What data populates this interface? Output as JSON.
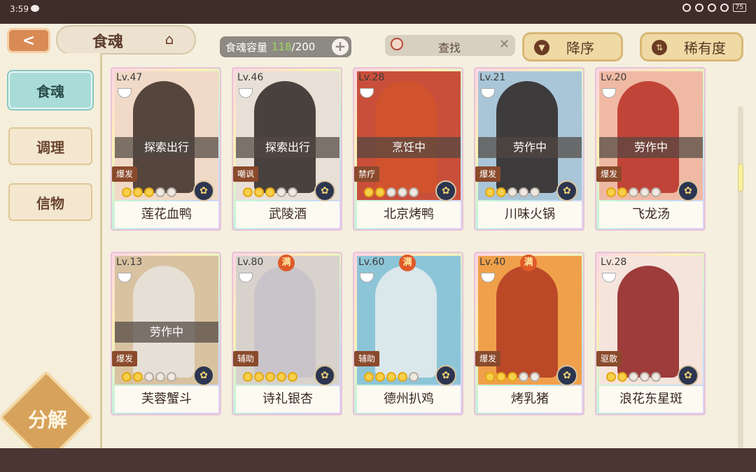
{
  "status_bar": {
    "time": "3:59",
    "battery": "75"
  },
  "header": {
    "title": "食魂",
    "capacity_label": "食魂容量",
    "capacity_current": "118",
    "capacity_max": "/200",
    "search_label": "查找",
    "sort_desc_label": "降序",
    "sort_rarity_label": "稀有度"
  },
  "sidebar": {
    "tabs": [
      {
        "label": "食魂"
      },
      {
        "label": "调理"
      },
      {
        "label": "信物"
      }
    ],
    "decompose_label": "分解"
  },
  "cards": [
    {
      "level": "Lv.47",
      "status": "探索出行",
      "role": "爆发",
      "stars": 3,
      "name": "莲花血鸭",
      "max": false
    },
    {
      "level": "Lv.46",
      "status": "探索出行",
      "role": "嘲讽",
      "stars": 3,
      "name": "武陵酒",
      "max": false
    },
    {
      "level": "Lv.28",
      "status": "烹饪中",
      "role": "禁疗",
      "stars": 2,
      "name": "北京烤鸭",
      "max": false
    },
    {
      "level": "Lv.21",
      "status": "劳作中",
      "role": "爆发",
      "stars": 2,
      "name": "川味火锅",
      "max": false
    },
    {
      "level": "Lv.20",
      "status": "劳作中",
      "role": "爆发",
      "stars": 2,
      "name": "飞龙汤",
      "max": false
    },
    {
      "level": "Lv.13",
      "status": "劳作中",
      "role": "爆发",
      "stars": 2,
      "name": "芙蓉蟹斗",
      "max": false
    },
    {
      "level": "Lv.80",
      "status": "",
      "role": "辅助",
      "max_label": "满",
      "stars": 5,
      "name": "诗礼银杏",
      "max": true
    },
    {
      "level": "Lv.60",
      "status": "",
      "role": "辅助",
      "max_label": "满",
      "stars": 4,
      "name": "德州扒鸡",
      "max": true
    },
    {
      "level": "Lv.40",
      "status": "",
      "role": "爆发",
      "max_label": "满",
      "stars": 3,
      "name": "烤乳猪",
      "max": true
    },
    {
      "level": "Lv.28",
      "status": "",
      "role": "驱散",
      "stars": 2,
      "name": "浪花东星斑",
      "max": false
    }
  ]
}
